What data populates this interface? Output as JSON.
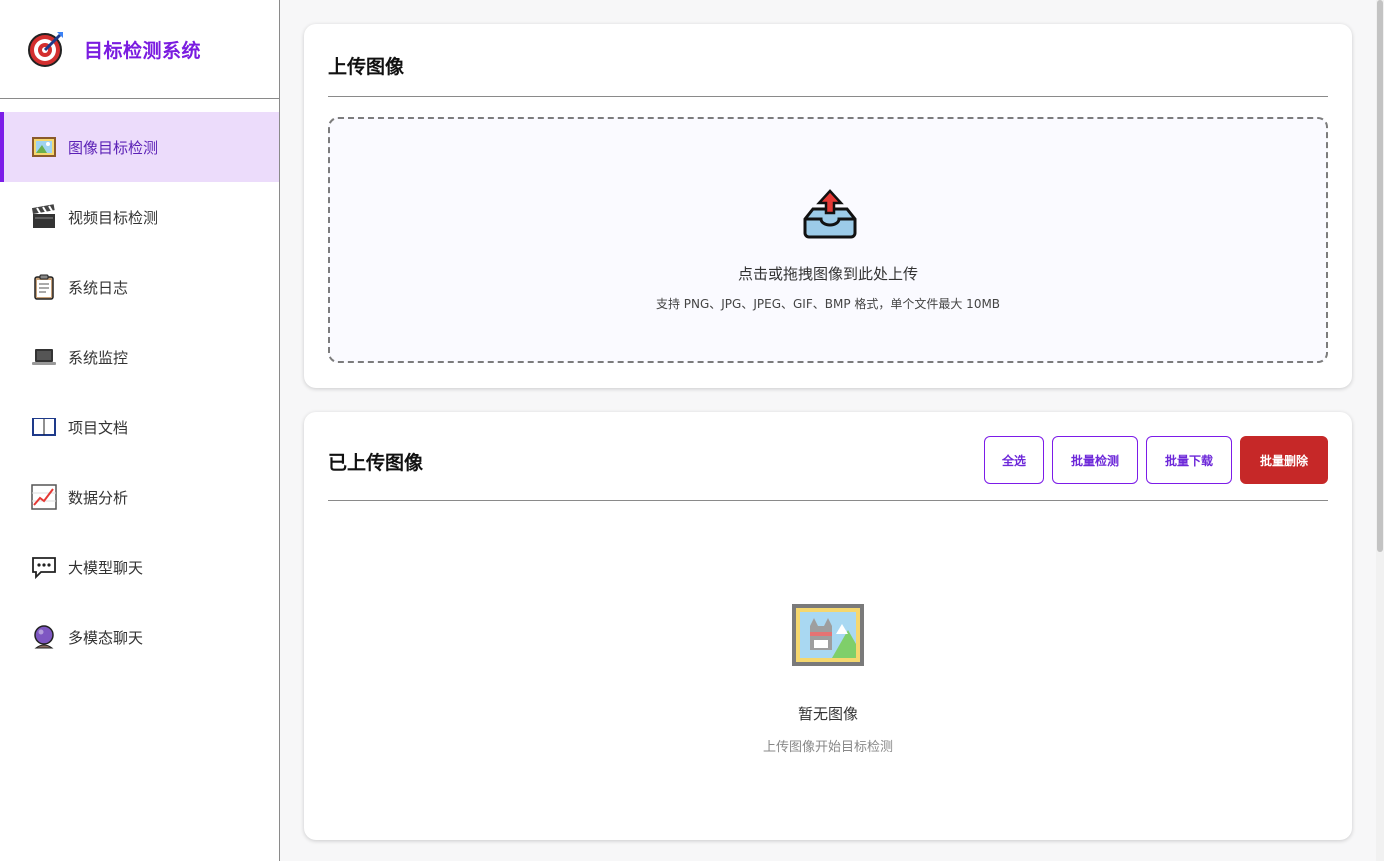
{
  "brand": {
    "title": "目标检测系统"
  },
  "nav": [
    {
      "label": "图像目标检测",
      "icon": "framed-picture-icon",
      "active": true
    },
    {
      "label": "视频目标检测",
      "icon": "clapper-board-icon"
    },
    {
      "label": "系统日志",
      "icon": "clipboard-icon"
    },
    {
      "label": "系统监控",
      "icon": "laptop-icon"
    },
    {
      "label": "项目文档",
      "icon": "open-book-icon"
    },
    {
      "label": "数据分析",
      "icon": "chart-increasing-icon"
    },
    {
      "label": "大模型聊天",
      "icon": "speech-bubble-icon"
    },
    {
      "label": "多模态聊天",
      "icon": "crystal-ball-icon"
    }
  ],
  "upload": {
    "title": "上传图像",
    "drop_text": "点击或拖拽图像到此处上传",
    "hint": "支持 PNG、JPG、JPEG、GIF、BMP 格式，单个文件最大 10MB"
  },
  "uploaded": {
    "title": "已上传图像",
    "select_all": "全选",
    "batch_detect": "批量检测",
    "batch_download": "批量下载",
    "batch_delete": "批量删除",
    "empty_title": "暂无图像",
    "empty_sub": "上传图像开始目标检测"
  },
  "colors": {
    "accent": "#7c1ce8",
    "danger": "#c62828",
    "active_bg": "#ecdcfb"
  }
}
